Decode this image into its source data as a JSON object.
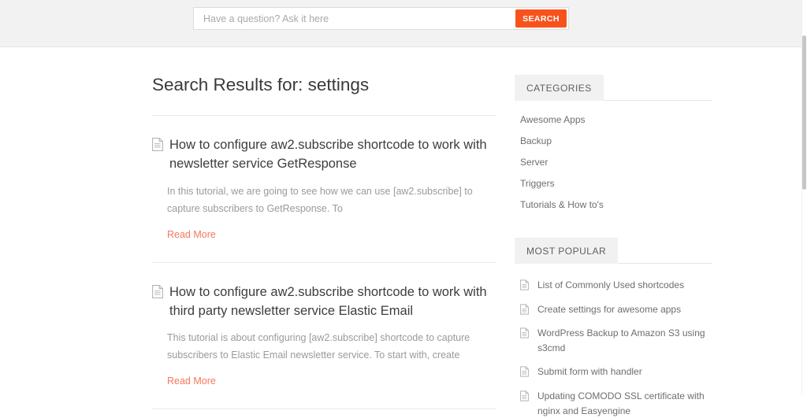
{
  "search": {
    "placeholder": "Have a question? Ask it here",
    "value": "",
    "button_label": "SEARCH",
    "button_color": "#f8521c"
  },
  "main": {
    "page_title": "Search Results for: settings",
    "read_more_label": "Read More",
    "link_color": "#f7775a",
    "results": [
      {
        "icon": "document-icon",
        "title": "How to configure aw2.subscribe shortcode to work with newsletter service GetResponse",
        "excerpt": "In this tutorial, we are going to see how we can use [aw2.subscribe] to capture subscribers to GetResponse. To",
        "read_more": "Read More"
      },
      {
        "icon": "document-icon",
        "title": "How to configure aw2.subscribe shortcode to work with third party newsletter service Elastic Email",
        "excerpt": "This tutorial is about configuring [aw2.subscribe] shortcode to capture subscribers to Elastic Email newsletter service. To start with, create",
        "read_more": "Read More"
      }
    ]
  },
  "sidebar": {
    "categories": {
      "heading": "CATEGORIES",
      "items": [
        {
          "label": "Awesome Apps"
        },
        {
          "label": "Backup"
        },
        {
          "label": "Server"
        },
        {
          "label": "Triggers"
        },
        {
          "label": "Tutorials & How to's"
        }
      ]
    },
    "most_popular": {
      "heading": "MOST POPULAR",
      "items": [
        {
          "icon": "document-icon",
          "label": "List of Commonly Used shortcodes"
        },
        {
          "icon": "document-icon",
          "label": "Create settings for awesome apps"
        },
        {
          "icon": "document-icon",
          "label": "WordPress Backup to Amazon S3 using s3cmd"
        },
        {
          "icon": "document-icon",
          "label": "Submit form with handler"
        },
        {
          "icon": "document-icon",
          "label": "Updating COMODO SSL certificate with nginx and Easyengine"
        }
      ]
    }
  },
  "scrollbar": {
    "name": "vertical-scrollbar"
  }
}
